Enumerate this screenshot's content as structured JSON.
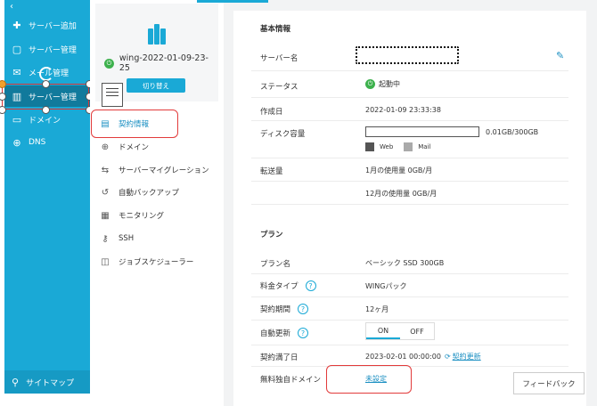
{
  "sidebar": {
    "items": [
      {
        "label": "サーバー追加",
        "icon": "plus-icon"
      },
      {
        "label": "サーバー管理",
        "icon": "window-icon"
      },
      {
        "label": "メール管理",
        "icon": "mail-icon"
      },
      {
        "label": "サーバー管理",
        "icon": "server-icon"
      },
      {
        "label": "ドメイン",
        "icon": "monitor-icon"
      },
      {
        "label": "DNS",
        "icon": "globe-icon"
      }
    ],
    "bottom_label": "サイトマップ"
  },
  "server_card": {
    "name": "wing-2022-01-09-23-25",
    "switch_label": "切り替え"
  },
  "subnav": {
    "items": [
      {
        "label": "契約情報",
        "icon": "contract-icon"
      },
      {
        "label": "ドメイン",
        "icon": "globe-icon"
      },
      {
        "label": "サーバーマイグレーション",
        "icon": "migration-icon"
      },
      {
        "label": "自動バックアップ",
        "icon": "backup-icon"
      },
      {
        "label": "モニタリング",
        "icon": "chart-icon"
      },
      {
        "label": "SSH",
        "icon": "key-icon"
      },
      {
        "label": "ジョブスケジューラー",
        "icon": "scheduler-icon"
      }
    ]
  },
  "basic_info": {
    "title": "基本情報",
    "server_name_label": "サーバー名",
    "status_label": "ステータス",
    "status_value": "起動中",
    "created_label": "作成日",
    "created_value": "2022-01-09 23:33:38",
    "disk_label": "ディスク容量",
    "disk_value": "0.01GB/300GB",
    "disk_web": "Web",
    "disk_mail": "Mail",
    "transfer_label": "転送量",
    "transfer_month": "1月の使用量 0GB/月",
    "transfer_dec": "12月の使用量 0GB/月"
  },
  "plan": {
    "title": "プラン",
    "name_label": "プラン名",
    "name_value": "ベーシック SSD 300GB",
    "fee_label": "料金タイプ",
    "fee_value": "WINGパック",
    "period_label": "契約期間",
    "period_value": "12ヶ月",
    "auto_label": "自動更新",
    "auto_on": "ON",
    "auto_off": "OFF",
    "expire_label": "契約満了日",
    "expire_value": "2023-02-01 00:00:00",
    "renew_link": "契約更新",
    "domain_label": "無料独自ドメイン",
    "domain_value": "未設定"
  },
  "feedback_label": "フィードバック",
  "help_glyph": "?",
  "colors": {
    "accent": "#1aa9d6",
    "sidebar_active": "#117a9c",
    "status_green": "#3db14d",
    "highlight_red": "#e23b3b"
  }
}
